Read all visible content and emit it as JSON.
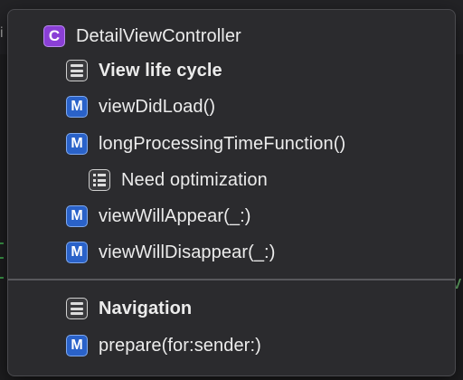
{
  "symbols": [
    {
      "kind": "class",
      "badge": "C",
      "label": "DetailViewController",
      "bold": false
    },
    {
      "kind": "mark",
      "badge": "",
      "label": "View life cycle",
      "bold": true
    },
    {
      "kind": "method",
      "badge": "M",
      "label": "viewDidLoad()",
      "bold": false
    },
    {
      "kind": "method",
      "badge": "M",
      "label": "longProcessingTimeFunction()",
      "bold": false
    },
    {
      "kind": "todo",
      "badge": "",
      "label": "Need optimization",
      "bold": false
    },
    {
      "kind": "method",
      "badge": "M",
      "label": "viewWillAppear(_:)",
      "bold": false
    },
    {
      "kind": "method",
      "badge": "M",
      "label": "viewWillDisappear(_:)",
      "bold": false
    },
    {
      "kind": "mark",
      "badge": "",
      "label": "Navigation",
      "bold": true
    },
    {
      "kind": "method",
      "badge": "M",
      "label": "prepare(for:sender:)",
      "bold": false
    }
  ],
  "colors": {
    "class_badge": "#8a3fd6",
    "method_badge": "#2a62c9",
    "popup_bg": "#2b2b2e",
    "text": "#ececec"
  },
  "background": {
    "left_glyph": "i",
    "right_glyph": "v"
  }
}
